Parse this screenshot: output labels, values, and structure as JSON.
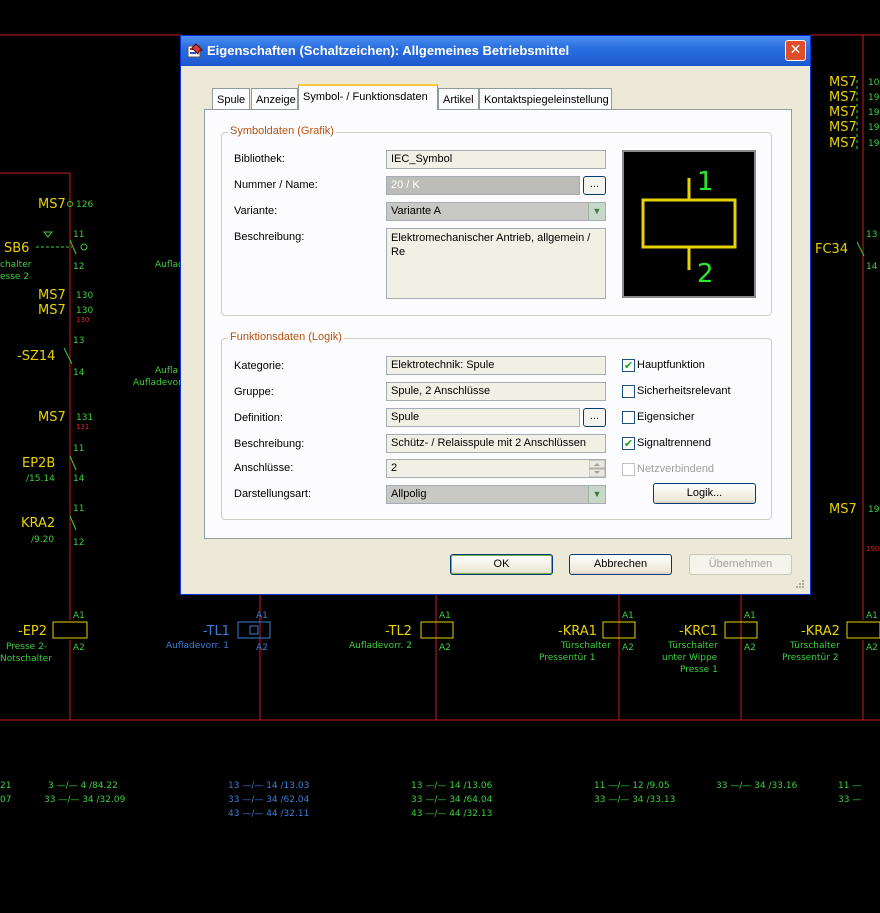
{
  "dialog": {
    "title": "Eigenschaften (Schaltzeichen): Allgemeines Betriebsmittel",
    "close": "✕",
    "tabs": [
      {
        "label": "Spule"
      },
      {
        "label": "Anzeige"
      },
      {
        "label": "Symbol- / Funktionsdaten",
        "active": true
      },
      {
        "label": "Artikel"
      },
      {
        "label": "Kontaktspiegeleinstellung"
      }
    ],
    "symbol_group": {
      "title": "Symboldaten (Grafik)",
      "bibliothek_label": "Bibliothek:",
      "bibliothek_value": "IEC_Symbol",
      "nummer_label": "Nummer / Name:",
      "nummer_value": "20 / K",
      "variante_label": "Variante:",
      "variante_value": "Variante A",
      "beschreibung_label": "Beschreibung:",
      "beschreibung_value": "Elektromechanischer Antrieb, allgemein / Re",
      "preview_pin_top": "1",
      "preview_pin_bottom": "2"
    },
    "function_group": {
      "title": "Funktionsdaten (Logik)",
      "kategorie_label": "Kategorie:",
      "kategorie_value": "Elektrotechnik: Spule",
      "gruppe_label": "Gruppe:",
      "gruppe_value": "Spule, 2 Anschlüsse",
      "definition_label": "Definition:",
      "definition_value": "Spule",
      "beschreibung_label": "Beschreibung:",
      "beschreibung_value": "Schütz- / Relaisspule mit 2 Anschlüssen",
      "anschluesse_label": "Anschlüsse:",
      "anschluesse_value": "2",
      "darstellung_label": "Darstellungsart:",
      "darstellung_value": "Allpolig",
      "checkboxes": [
        {
          "label": "Hauptfunktion",
          "checked": true,
          "enabled": true
        },
        {
          "label": "Sicherheitsrelevant",
          "checked": false,
          "enabled": true
        },
        {
          "label": "Eigensicher",
          "checked": false,
          "enabled": true
        },
        {
          "label": "Signaltrennend",
          "checked": true,
          "enabled": true
        },
        {
          "label": "Netzverbindend",
          "checked": false,
          "enabled": false
        }
      ],
      "logik_button": "Logik..."
    },
    "buttons": {
      "ok": "OK",
      "cancel": "Abbrechen",
      "apply": "Übernehmen"
    },
    "dots_label": "..."
  },
  "schematic": {
    "left": {
      "ms7_1": "MS7",
      "ms7_1_num": "126",
      "sb6": "SB6",
      "sb6_top": "11",
      "sb6_bot": "12",
      "sb6_desc1": "chalter",
      "sb6_desc2": "esse 2",
      "aufla_1": "Auflad",
      "ms7_2": "MS7",
      "ms7_2_num": "130",
      "ms7_3": "MS7",
      "ms7_3_num": "130",
      "ms7_3_red": "130",
      "sz14": "-SZ14",
      "sz14_top": "13",
      "sz14_bot": "14",
      "aufla_2": "Aufla",
      "aufla_3": "Aufladevor",
      "ms7_4": "MS7",
      "ms7_4_num": "131",
      "ms7_4_red": "131",
      "ep2b": "EP2B",
      "ep2b_ref": "/15.14",
      "ep2b_top": "11",
      "ep2b_bot": "14",
      "kra2": "KRA2",
      "kra2_ref": "/9.20",
      "kra2_top": "11",
      "kra2_bot": "12"
    },
    "right": {
      "ms7_labels": [
        "MS7",
        "MS7",
        "MS7",
        "MS7",
        "MS7"
      ],
      "ms7_nums": [
        "10",
        "19",
        "19",
        "19",
        "19"
      ],
      "fc34": "FC34",
      "fc34_top": "13",
      "fc34_bot": "14",
      "ms7_bottom": "MS7",
      "ms7_bottom_num": "19",
      "red_num": "190"
    },
    "coils": [
      {
        "name": "-EP2",
        "a1": "A1",
        "a2": "A2",
        "desc1": "Presse 2-",
        "desc2": "Notschalter",
        "desc3": ""
      },
      {
        "name": "-TL1",
        "a1": "A1",
        "a2": "A2",
        "desc1": "Aufladevorr. 1",
        "desc2": "",
        "desc3": ""
      },
      {
        "name": "-TL2",
        "a1": "A1",
        "a2": "A2",
        "desc1": "Aufladevorr. 2",
        "desc2": "",
        "desc3": ""
      },
      {
        "name": "-KRA1",
        "a1": "A1",
        "a2": "A2",
        "desc1": "Türschalter",
        "desc2": "Pressentür 1",
        "desc3": ""
      },
      {
        "name": "-KRC1",
        "a1": "A1",
        "a2": "A2",
        "desc1": "Türschalter",
        "desc2": "unter Wippe",
        "desc3": "Presse 1"
      },
      {
        "name": "-KRA2",
        "a1": "A1",
        "a2": "A2",
        "desc1": "Türschalter",
        "desc2": "Pressentür 2",
        "desc3": ""
      }
    ],
    "contacts": [
      {
        "lines": [
          "21",
          "07"
        ]
      },
      {
        "lines": [
          "3 —/— 4  /84.22",
          "33 —/— 34 /32.09"
        ]
      },
      {
        "lines": [
          "13 —/— 14 /13.03",
          "33 —/— 34 /62.04",
          "43 —/— 44 /32.11"
        ]
      },
      {
        "lines": [
          "13 —/— 14 /13.06",
          "33 —/— 34 /64.04",
          "43 —/— 44 /32.13"
        ]
      },
      {
        "lines": [
          "11 —/— 12 /9.05",
          "33 —/— 34 /33.13"
        ]
      },
      {
        "lines": [
          "33 —/— 34 /33.16"
        ]
      },
      {
        "lines": [
          "11 —",
          "33 —"
        ]
      }
    ]
  }
}
